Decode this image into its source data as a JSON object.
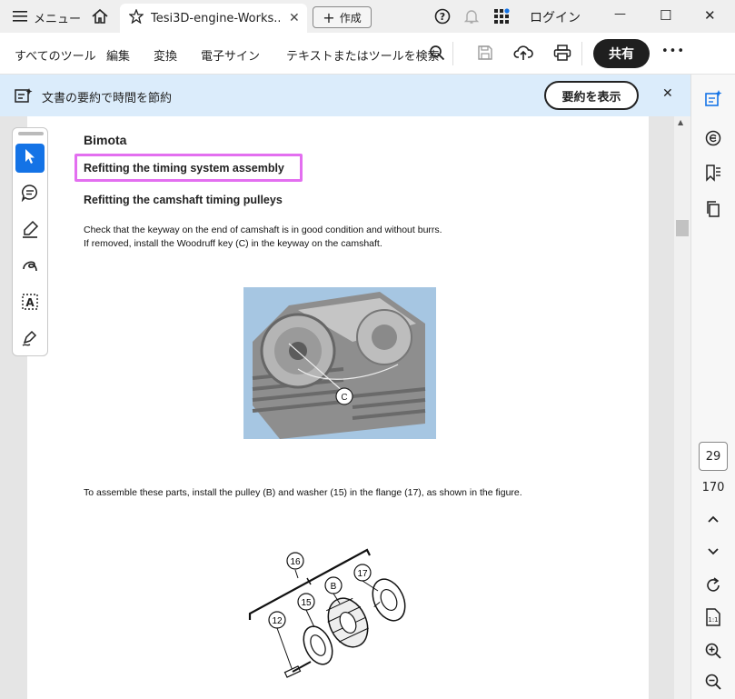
{
  "titlebar": {
    "menu_label": "メニュー",
    "tab_title": "Tesi3D-engine-Works...",
    "tab_close": "✕",
    "new_tab_label": "作成",
    "login_label": "ログイン",
    "minimize": "—",
    "maximize": "☐",
    "close": "✕"
  },
  "toolbar": {
    "all_tools": "すべてのツール",
    "edit": "編集",
    "convert": "変換",
    "esign": "電子サイン",
    "search_placeholder": "テキストまたはツールを検索",
    "share": "共有",
    "more": "•••"
  },
  "banner": {
    "text": "文書の要約で時間を節約",
    "button": "要約を表示",
    "close": "✕"
  },
  "navigation": {
    "current_page": "29",
    "total_pages": "170"
  },
  "document": {
    "brand": "Bimota",
    "heading_1": "Refitting the timing system assembly",
    "heading_2": "Refitting the camshaft timing pulleys",
    "para_1_line_1": "Check that the keyway on the end of camshaft is in good condition and without burrs.",
    "para_1_line_2": "If removed, install the Woodruff key (C) in the keyway on the camshaft.",
    "photo_label": "C",
    "para_2": "To assemble these parts, install the pulley (B) and washer (15) in the flange (17), as shown in the figure.",
    "diagram_labels": {
      "l16": "16",
      "l15": "15",
      "lB": "B",
      "l17": "17",
      "l12": "12"
    }
  },
  "colors": {
    "accent": "#1473e6",
    "banner_bg": "#dbecfb",
    "highlight_border": "#e36ff0",
    "share_bg": "#1f1f1f"
  }
}
